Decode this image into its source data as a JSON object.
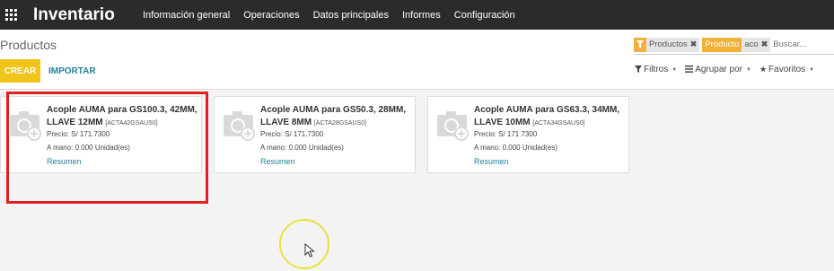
{
  "navbar": {
    "brand": "Inventario",
    "menu": [
      "Información general",
      "Operaciones",
      "Datos principales",
      "Informes",
      "Configuración"
    ]
  },
  "control_panel": {
    "title": "Productos",
    "create_label": "CREAR",
    "import_label": "IMPORTAR",
    "search": {
      "facets": [
        {
          "label": "",
          "value": "Productos"
        },
        {
          "label": "Producto",
          "value": "aco"
        }
      ],
      "placeholder": "Buscar..."
    },
    "filters_label": "Filtros",
    "groupby_label": "Agrupar por",
    "favorites_label": "Favoritos"
  },
  "products": [
    {
      "name": "Acople AUMA para GS100.3, 42MM, LLAVE 12MM",
      "code": "[ACTA42GSAUS0]",
      "price": "Precio: S/ 171.7300",
      "stock": "A mano: 0.000 Unidad(es)",
      "link": "Resumen"
    },
    {
      "name": "Acople AUMA para GS50.3, 28MM, LLAVE 8MM",
      "code": "[ACTA28GSAUS0]",
      "price": "Precio: S/ 171.7300",
      "stock": "A mano: 0.000 Unidad(es)",
      "link": "Resumen"
    },
    {
      "name": "Acople AUMA para GS63.3, 34MM, LLAVE 10MM",
      "code": "[ACTA34GSAUS0]",
      "price": "Precio: S/ 171.7300",
      "stock": "A mano: 0.000 Unidad(es)",
      "link": "Resumen"
    }
  ],
  "colors": {
    "navbar": "#2b2b2b",
    "primary_button": "#f0c419",
    "link": "#21829a",
    "highlight_box": "#e02020",
    "cursor_ring": "#e8e040"
  }
}
